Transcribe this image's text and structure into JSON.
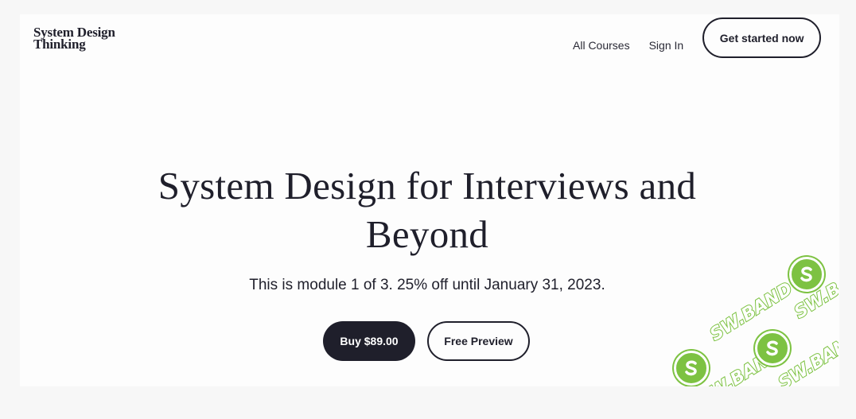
{
  "header": {
    "logo_line1": "System Design",
    "logo_line2": "Thinking",
    "nav": {
      "all_courses": "All Courses",
      "sign_in": "Sign In",
      "get_started": "Get started now"
    }
  },
  "hero": {
    "title_line1": "System Design for Interviews and",
    "title_line2": "Beyond",
    "subtitle": "This is module 1 of 3. 25% off until January 31, 2023.",
    "buy_label": "Buy $89.00",
    "preview_label": "Free Preview"
  },
  "watermark": {
    "text": "SW.BAND",
    "icon": "s-logo-icon",
    "color": "#7dc242"
  },
  "colors": {
    "primary_dark": "#1f1f2b",
    "background": "#fdfdfd"
  }
}
